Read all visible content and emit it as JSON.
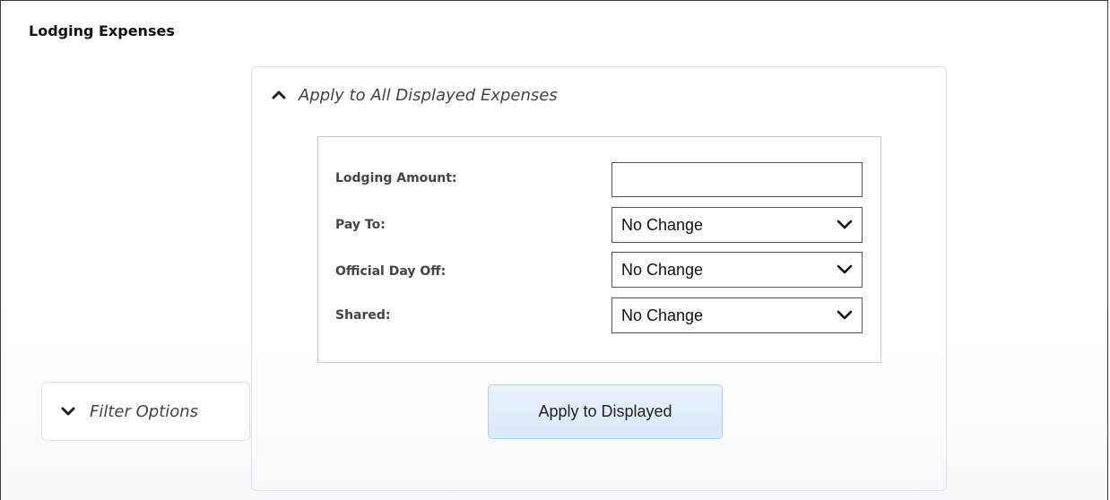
{
  "section": {
    "title": "Lodging Expenses"
  },
  "apply_panel": {
    "header_label": "Apply to All Displayed Expenses",
    "expanded": true,
    "header_icon": "chevron-up-icon",
    "fields": {
      "lodging_amount": {
        "label": "Lodging Amount:",
        "value": ""
      },
      "pay_to": {
        "label": "Pay To:",
        "value": "No Change"
      },
      "official_day_off": {
        "label": "Official Day Off:",
        "value": "No Change"
      },
      "shared": {
        "label": "Shared:",
        "value": "No Change"
      }
    },
    "apply_button_label": "Apply to Displayed"
  },
  "filter_panel": {
    "label": "Filter Options",
    "expanded": false,
    "header_icon": "chevron-down-icon"
  },
  "colors": {
    "button_bg": "#dce9f7",
    "button_border": "#b7d0ea",
    "panel_border": "#dde3e8"
  }
}
